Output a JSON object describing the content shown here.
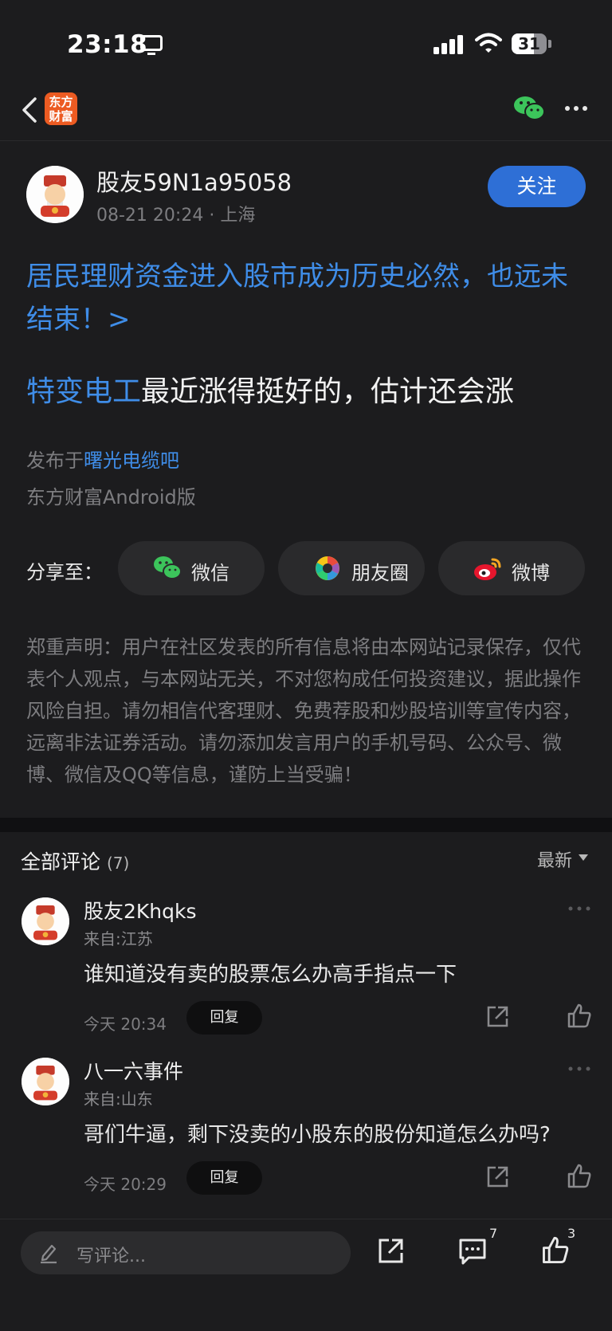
{
  "status_bar": {
    "time": "23:18",
    "battery": "31"
  },
  "nav": {
    "logo_text": "东方财富"
  },
  "post": {
    "author": "股友59N1a95058",
    "date": "08-21 20:24",
    "location": "上海",
    "follow_label": "关注",
    "headline": "居民理财资金进入股市成为历史必然，也远未结束！>",
    "stock_name": "特变电工",
    "body": "最近涨得挺好的，估计还会涨",
    "published_prefix": "发布于",
    "bar_name": "曙光电缆吧",
    "client": "东方财富Android版"
  },
  "share": {
    "label": "分享至：",
    "options": [
      {
        "label": "微信",
        "icon": "wechat-icon"
      },
      {
        "label": "朋友圈",
        "icon": "moments-icon"
      },
      {
        "label": "微博",
        "icon": "weibo-icon"
      }
    ]
  },
  "disclaimer": "郑重声明：用户在社区发表的所有信息将由本网站记录保存，仅代表个人观点，与本网站无关，不对您构成任何投资建议，据此操作风险自担。请勿相信代客理财、免费荐股和炒股培训等宣传内容，远离非法证券活动。请勿添加发言用户的手机号码、公众号、微博、微信及QQ等信息，谨防上当受骗！",
  "comments": {
    "title": "全部评论",
    "count": "(7)",
    "sort": "最新",
    "items": [
      {
        "name": "股友2Khqks",
        "location": "来自:江苏",
        "text": "谁知道没有卖的股票怎么办高手指点一下",
        "time": "今天 20:34",
        "reply_label": "回复"
      },
      {
        "name": "八一六事件",
        "location": "来自:山东",
        "text": "哥们牛逼，剩下没卖的小股东的股份知道怎么办吗?",
        "time": "今天 20:29",
        "reply_label": "回复"
      }
    ]
  },
  "bottom_bar": {
    "placeholder": "写评论...",
    "comment_count": "7",
    "like_count": "3"
  },
  "colors": {
    "accent": "#3f8de8",
    "follow": "#2e6fd6",
    "background": "#1c1c1e",
    "logo": "#ec5b22"
  }
}
